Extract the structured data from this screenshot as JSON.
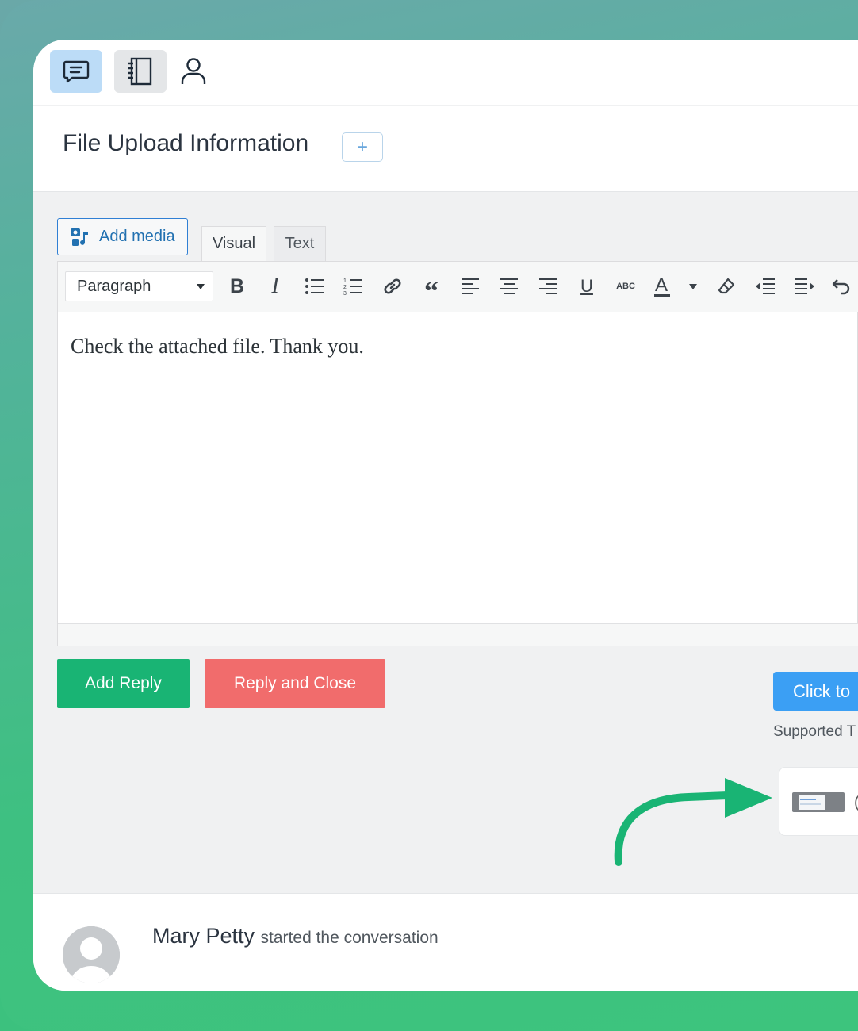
{
  "topbar": {
    "icons": [
      "chat-icon",
      "notebook-icon",
      "user-icon"
    ]
  },
  "header": {
    "title": "File Upload Information",
    "add_label": "+"
  },
  "editor": {
    "add_media_label": "Add media",
    "tabs": [
      {
        "label": "Visual",
        "active": true
      },
      {
        "label": "Text",
        "active": false
      }
    ],
    "format_select": "Paragraph",
    "toolbar_icons": [
      "bold-icon",
      "italic-icon",
      "bullet-list-icon",
      "numbered-list-icon",
      "link-icon",
      "blockquote-icon",
      "align-left-icon",
      "align-center-icon",
      "align-right-icon",
      "underline-icon",
      "strikethrough-icon",
      "text-color-icon",
      "clear-format-icon",
      "outdent-icon",
      "indent-icon",
      "undo-icon"
    ],
    "content": "Check the attached file. Thank you."
  },
  "actions": {
    "add_reply": "Add Reply",
    "reply_close": "Reply and Close",
    "upload_button": "Click to",
    "supported_text": "Supported T",
    "file_more": "("
  },
  "colors": {
    "add_reply": "#19b474",
    "reply_close": "#f16c6c",
    "upload": "#3b9ff4",
    "arrow": "#19b474"
  },
  "conversation": {
    "author": "Mary Petty",
    "action": "started the conversation"
  }
}
